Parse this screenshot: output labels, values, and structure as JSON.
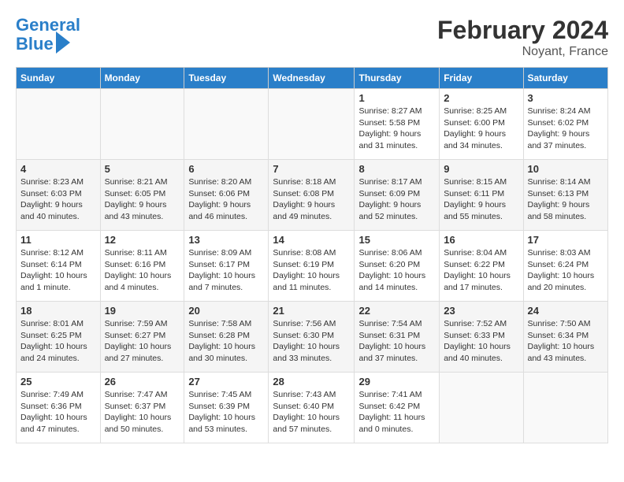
{
  "header": {
    "logo_line1": "General",
    "logo_line2": "Blue",
    "title": "February 2024",
    "subtitle": "Noyant, France"
  },
  "days_of_week": [
    "Sunday",
    "Monday",
    "Tuesday",
    "Wednesday",
    "Thursday",
    "Friday",
    "Saturday"
  ],
  "weeks": [
    [
      {
        "num": "",
        "info": ""
      },
      {
        "num": "",
        "info": ""
      },
      {
        "num": "",
        "info": ""
      },
      {
        "num": "",
        "info": ""
      },
      {
        "num": "1",
        "info": "Sunrise: 8:27 AM\nSunset: 5:58 PM\nDaylight: 9 hours and 31 minutes."
      },
      {
        "num": "2",
        "info": "Sunrise: 8:25 AM\nSunset: 6:00 PM\nDaylight: 9 hours and 34 minutes."
      },
      {
        "num": "3",
        "info": "Sunrise: 8:24 AM\nSunset: 6:02 PM\nDaylight: 9 hours and 37 minutes."
      }
    ],
    [
      {
        "num": "4",
        "info": "Sunrise: 8:23 AM\nSunset: 6:03 PM\nDaylight: 9 hours and 40 minutes."
      },
      {
        "num": "5",
        "info": "Sunrise: 8:21 AM\nSunset: 6:05 PM\nDaylight: 9 hours and 43 minutes."
      },
      {
        "num": "6",
        "info": "Sunrise: 8:20 AM\nSunset: 6:06 PM\nDaylight: 9 hours and 46 minutes."
      },
      {
        "num": "7",
        "info": "Sunrise: 8:18 AM\nSunset: 6:08 PM\nDaylight: 9 hours and 49 minutes."
      },
      {
        "num": "8",
        "info": "Sunrise: 8:17 AM\nSunset: 6:09 PM\nDaylight: 9 hours and 52 minutes."
      },
      {
        "num": "9",
        "info": "Sunrise: 8:15 AM\nSunset: 6:11 PM\nDaylight: 9 hours and 55 minutes."
      },
      {
        "num": "10",
        "info": "Sunrise: 8:14 AM\nSunset: 6:13 PM\nDaylight: 9 hours and 58 minutes."
      }
    ],
    [
      {
        "num": "11",
        "info": "Sunrise: 8:12 AM\nSunset: 6:14 PM\nDaylight: 10 hours and 1 minute."
      },
      {
        "num": "12",
        "info": "Sunrise: 8:11 AM\nSunset: 6:16 PM\nDaylight: 10 hours and 4 minutes."
      },
      {
        "num": "13",
        "info": "Sunrise: 8:09 AM\nSunset: 6:17 PM\nDaylight: 10 hours and 7 minutes."
      },
      {
        "num": "14",
        "info": "Sunrise: 8:08 AM\nSunset: 6:19 PM\nDaylight: 10 hours and 11 minutes."
      },
      {
        "num": "15",
        "info": "Sunrise: 8:06 AM\nSunset: 6:20 PM\nDaylight: 10 hours and 14 minutes."
      },
      {
        "num": "16",
        "info": "Sunrise: 8:04 AM\nSunset: 6:22 PM\nDaylight: 10 hours and 17 minutes."
      },
      {
        "num": "17",
        "info": "Sunrise: 8:03 AM\nSunset: 6:24 PM\nDaylight: 10 hours and 20 minutes."
      }
    ],
    [
      {
        "num": "18",
        "info": "Sunrise: 8:01 AM\nSunset: 6:25 PM\nDaylight: 10 hours and 24 minutes."
      },
      {
        "num": "19",
        "info": "Sunrise: 7:59 AM\nSunset: 6:27 PM\nDaylight: 10 hours and 27 minutes."
      },
      {
        "num": "20",
        "info": "Sunrise: 7:58 AM\nSunset: 6:28 PM\nDaylight: 10 hours and 30 minutes."
      },
      {
        "num": "21",
        "info": "Sunrise: 7:56 AM\nSunset: 6:30 PM\nDaylight: 10 hours and 33 minutes."
      },
      {
        "num": "22",
        "info": "Sunrise: 7:54 AM\nSunset: 6:31 PM\nDaylight: 10 hours and 37 minutes."
      },
      {
        "num": "23",
        "info": "Sunrise: 7:52 AM\nSunset: 6:33 PM\nDaylight: 10 hours and 40 minutes."
      },
      {
        "num": "24",
        "info": "Sunrise: 7:50 AM\nSunset: 6:34 PM\nDaylight: 10 hours and 43 minutes."
      }
    ],
    [
      {
        "num": "25",
        "info": "Sunrise: 7:49 AM\nSunset: 6:36 PM\nDaylight: 10 hours and 47 minutes."
      },
      {
        "num": "26",
        "info": "Sunrise: 7:47 AM\nSunset: 6:37 PM\nDaylight: 10 hours and 50 minutes."
      },
      {
        "num": "27",
        "info": "Sunrise: 7:45 AM\nSunset: 6:39 PM\nDaylight: 10 hours and 53 minutes."
      },
      {
        "num": "28",
        "info": "Sunrise: 7:43 AM\nSunset: 6:40 PM\nDaylight: 10 hours and 57 minutes."
      },
      {
        "num": "29",
        "info": "Sunrise: 7:41 AM\nSunset: 6:42 PM\nDaylight: 11 hours and 0 minutes."
      },
      {
        "num": "",
        "info": ""
      },
      {
        "num": "",
        "info": ""
      }
    ]
  ]
}
